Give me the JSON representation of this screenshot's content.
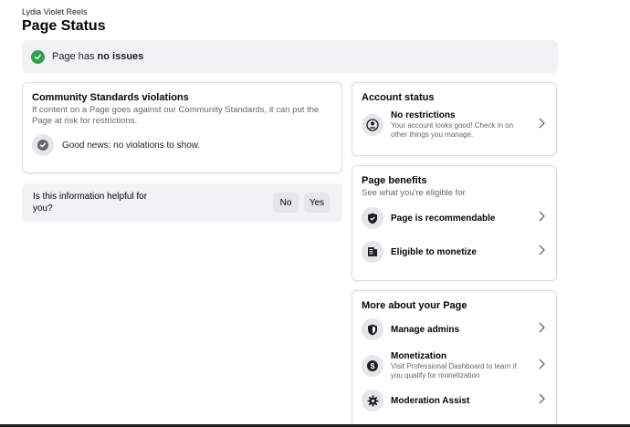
{
  "header": {
    "page_name": "Lydia Violet Reels",
    "title": "Page Status"
  },
  "status_banner": {
    "prefix": "Page has ",
    "emphasis": "no issues",
    "icon": "check-circle-icon",
    "color": "#31a24c"
  },
  "violations": {
    "title": "Community Standards violations",
    "description": "If content on a Page goes against our Community Standards, it can put the Page at risk for restrictions.",
    "good_news": "Good news: no violations to show."
  },
  "helpful": {
    "question": "Is this information helpful for you?",
    "no_label": "No",
    "yes_label": "Yes"
  },
  "account_status": {
    "title": "Account status",
    "item_title": "No restrictions",
    "item_desc": "Your account looks good! Check in on other things you manage."
  },
  "benefits": {
    "title": "Page benefits",
    "subtitle": "See what you're eligible for",
    "items": [
      {
        "label": "Page is recommendable",
        "icon": "shield-check-icon"
      },
      {
        "label": "Eligible to monetize",
        "icon": "document-icon"
      }
    ]
  },
  "more": {
    "title": "More about your Page",
    "items": [
      {
        "label": "Manage admins",
        "desc": "",
        "icon": "shield-icon"
      },
      {
        "label": "Monetization",
        "desc": "Visit Professional Dashboard to learn if you qualify for monetization",
        "icon": "dollar-icon"
      },
      {
        "label": "Moderation Assist",
        "desc": "",
        "icon": "gear-icon"
      }
    ]
  }
}
